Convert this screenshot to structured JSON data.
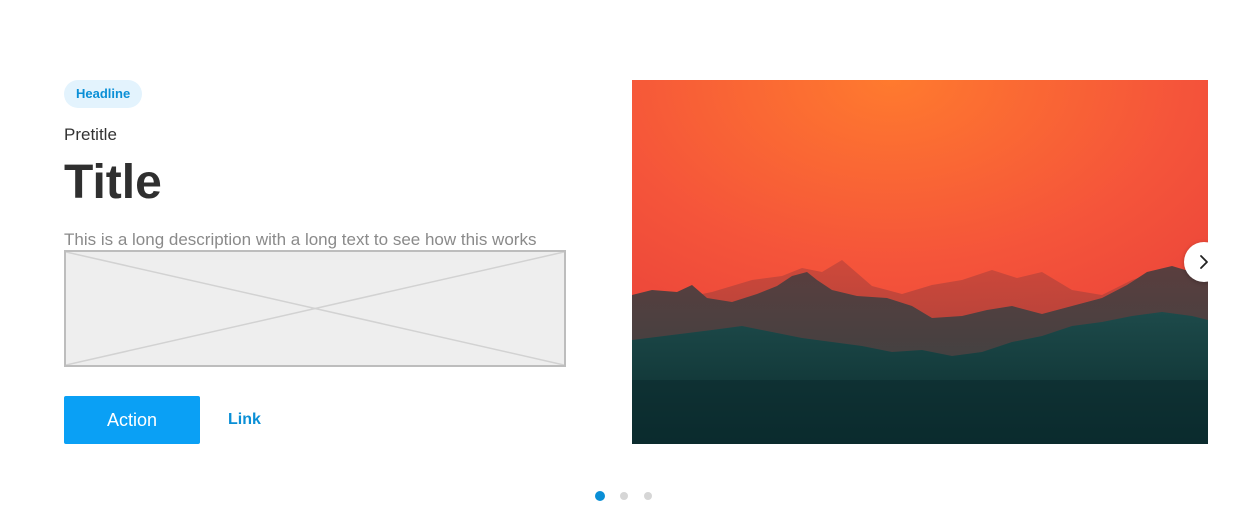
{
  "card": {
    "headline": "Headline",
    "pretitle": "Pretitle",
    "title": "Title",
    "description": "This is a long description with a long text to see how this works",
    "action_label": "Action",
    "link_label": "Link"
  },
  "pagination": {
    "count": 3,
    "active_index": 0
  },
  "colors": {
    "accent": "#0aa0f5",
    "link": "#0a8fd6",
    "badge_bg": "#e3f3fd",
    "dot_active": "#0a8fd6",
    "dot_inactive": "#d6d6d6"
  },
  "icons": {
    "next": "chevron-right-icon",
    "placeholder": "image-placeholder-icon"
  }
}
